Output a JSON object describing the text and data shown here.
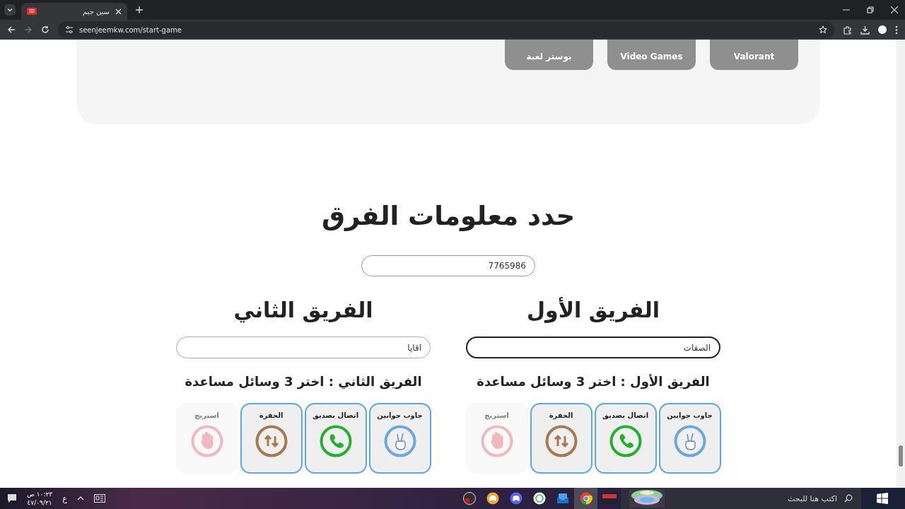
{
  "browser": {
    "tab_title": "سين جيم",
    "url": "seenjeemkw.com/start-game"
  },
  "categories": [
    {
      "label": "Valorant"
    },
    {
      "label": "Video Games"
    },
    {
      "label": "بوستر لعبة"
    }
  ],
  "title": "حدد معلومات الفرق",
  "game_code": "7765986",
  "teams": [
    {
      "name": "الفريق الأول",
      "team_name": "الصفات",
      "focused": true,
      "helpers_title": "الفريق الأول : اختر 3 وسائل مساعدة",
      "helpers": [
        {
          "kind": "answer",
          "label": "جاوب جوابين",
          "selected": true
        },
        {
          "kind": "call",
          "label": "اتصال بصديق",
          "selected": true
        },
        {
          "kind": "pit",
          "label": "الحفرة",
          "selected": true
        },
        {
          "kind": "rest",
          "label": "استريح",
          "selected": false
        }
      ]
    },
    {
      "name": "الفريق الثاني",
      "team_name": "اقايا",
      "focused": false,
      "helpers_title": "الفريق الثاني : اختر 3 وسائل مساعدة",
      "helpers": [
        {
          "kind": "answer",
          "label": "جاوب جوابين",
          "selected": true
        },
        {
          "kind": "call",
          "label": "اتصال بصديق",
          "selected": true
        },
        {
          "kind": "pit",
          "label": "الحفرة",
          "selected": true
        },
        {
          "kind": "rest",
          "label": "استريح",
          "selected": false
        }
      ]
    }
  ],
  "taskbar": {
    "search_placeholder": "اكتب هنا للبحث",
    "language": "ع",
    "time": "١٠:٢٣ ص",
    "date": "٤٧/٠٩/٢١"
  }
}
